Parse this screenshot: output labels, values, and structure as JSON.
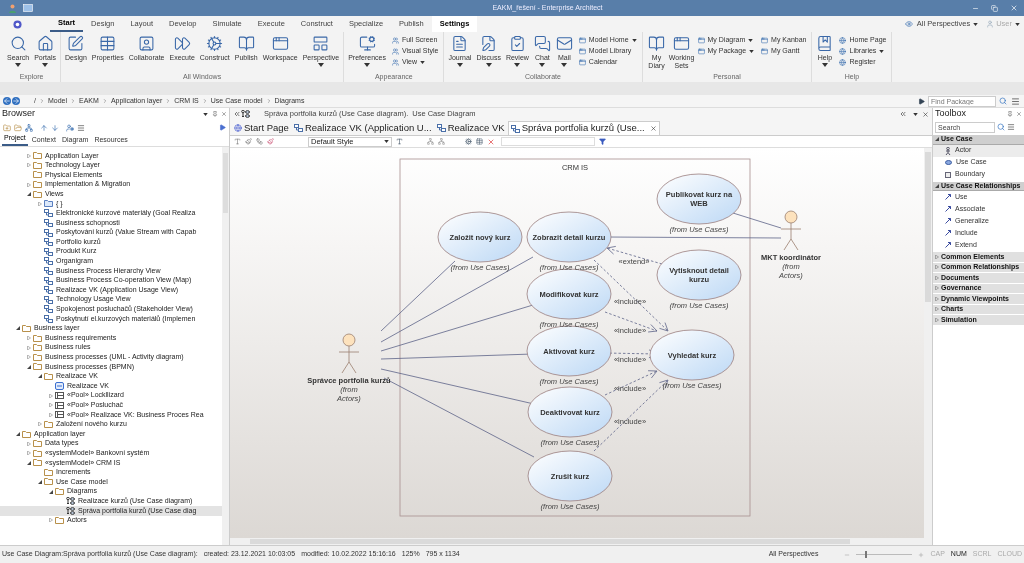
{
  "window": {
    "title": "EAKM_řešení - Enterprise Architect"
  },
  "ribbon": {
    "tabs": [
      {
        "label": "Start",
        "selected": true,
        "highlighted": false
      },
      {
        "label": "Design",
        "selected": false,
        "highlighted": false
      },
      {
        "label": "Layout",
        "selected": false,
        "highlighted": false
      },
      {
        "label": "Develop",
        "selected": false,
        "highlighted": false
      },
      {
        "label": "Simulate",
        "selected": false,
        "highlighted": false
      },
      {
        "label": "Execute",
        "selected": false,
        "highlighted": false
      },
      {
        "label": "Construct",
        "selected": false,
        "highlighted": false
      },
      {
        "label": "Specialize",
        "selected": false,
        "highlighted": false
      },
      {
        "label": "Publish",
        "selected": false,
        "highlighted": false
      },
      {
        "label": "Settings",
        "selected": false,
        "highlighted": true
      }
    ],
    "perspective": "All Perspectives",
    "user": "User",
    "groups": [
      {
        "label": "Explore",
        "items": [
          {
            "kind": "large",
            "label": "Search",
            "dropdown": true
          },
          {
            "kind": "large",
            "label": "Portals",
            "dropdown": true
          }
        ]
      },
      {
        "label": "All Windows",
        "items": [
          {
            "kind": "large",
            "label": "Design",
            "dropdown": false
          },
          {
            "kind": "large",
            "label": "Properties",
            "dropdown": false
          },
          {
            "kind": "large",
            "label": "Collaborate",
            "dropdown": false
          },
          {
            "kind": "large",
            "label": "Execute",
            "dropdown": false
          },
          {
            "kind": "large",
            "label": "Construct",
            "dropdown": false
          },
          {
            "kind": "large",
            "label": "Publish",
            "dropdown": false
          },
          {
            "kind": "large",
            "label": "Workspace",
            "dropdown": false
          },
          {
            "kind": "large",
            "label": "Perspective",
            "dropdown": true
          }
        ]
      },
      {
        "label": "Appearance",
        "items": [
          {
            "kind": "large",
            "label": "Preferences",
            "dropdown": true
          },
          {
            "kind": "stack",
            "items": [
              {
                "label": "Full Screen",
                "dropdown": false
              },
              {
                "label": "Visual Style",
                "dropdown": false
              },
              {
                "label": "View",
                "dropdown": true
              }
            ]
          }
        ]
      },
      {
        "label": "Collaborate",
        "items": [
          {
            "kind": "large",
            "label": "Journal",
            "dropdown": true
          },
          {
            "kind": "large",
            "label": "Discuss",
            "dropdown": true
          },
          {
            "kind": "large",
            "label": "Review",
            "dropdown": true
          },
          {
            "kind": "large",
            "label": "Chat",
            "dropdown": true
          },
          {
            "kind": "large",
            "label": "Mail",
            "dropdown": true
          },
          {
            "kind": "stack",
            "items": [
              {
                "label": "Model Home",
                "dropdown": true
              },
              {
                "label": "Model Library",
                "dropdown": false
              },
              {
                "label": "Calendar",
                "dropdown": false
              }
            ]
          }
        ]
      },
      {
        "label": "Personal",
        "items": [
          {
            "kind": "tall",
            "label": "My Diary",
            "dropdown": false
          },
          {
            "kind": "tall",
            "label": "Working Sets",
            "dropdown": false
          },
          {
            "kind": "stack",
            "items": [
              {
                "label": "My Diagram",
                "dropdown": true
              },
              {
                "label": "My Package",
                "dropdown": true
              }
            ]
          },
          {
            "kind": "stack",
            "items": [
              {
                "label": "My Kanban",
                "dropdown": false
              },
              {
                "label": "My Gantt",
                "dropdown": false
              }
            ]
          }
        ]
      },
      {
        "label": "Help",
        "items": [
          {
            "kind": "large",
            "label": "Help",
            "dropdown": true
          },
          {
            "kind": "stack",
            "items": [
              {
                "label": "Home Page",
                "dropdown": false
              },
              {
                "label": "Libraries",
                "dropdown": true
              },
              {
                "label": "Register",
                "dropdown": false
              }
            ]
          }
        ]
      }
    ]
  },
  "breadcrumb": {
    "items": [
      "/",
      "Model",
      "EAKM",
      "Application layer",
      "CRM IS",
      "Use Case model",
      "Diagrams"
    ],
    "search": {
      "placeholder": "Find Package"
    }
  },
  "browser": {
    "title": "Browser",
    "tabs": [
      {
        "label": "Project",
        "selected": true
      },
      {
        "label": "Context",
        "selected": false
      },
      {
        "label": "Diagram",
        "selected": false
      },
      {
        "label": "Resources",
        "selected": false
      }
    ],
    "tree": [
      {
        "children": [
          {
            "label": "Application Layer",
            "kind": "folder",
            "expanded": false,
            "selected": false
          },
          {
            "label": "Technology Layer",
            "kind": "folder",
            "expanded": false,
            "selected": false
          },
          {
            "label": "Physical Elements",
            "kind": "folder",
            "selected": false
          },
          {
            "label": "Implementation & Migration",
            "kind": "folder",
            "expanded": false,
            "selected": false
          },
          {
            "label": "Views",
            "kind": "folder",
            "expanded": true,
            "selected": false,
            "children": [
              {
                "label": "{ }",
                "kind": "package",
                "expanded": false,
                "selected": false
              },
              {
                "label": "Elektronické kurzové materiály (Goal Realiza",
                "kind": "view",
                "selected": false
              },
              {
                "label": "Business schopnosti",
                "kind": "view",
                "selected": false
              },
              {
                "label": "Poskytování kurzů (Value Stream with Capab",
                "kind": "view",
                "selected": false
              },
              {
                "label": "Portfolio kurzů",
                "kind": "view",
                "selected": false
              },
              {
                "label": "Produkt Kurz",
                "kind": "view",
                "selected": false
              },
              {
                "label": "Organigram",
                "kind": "view",
                "selected": false
              },
              {
                "label": "Business Process Hierarchy View",
                "kind": "view",
                "selected": false
              },
              {
                "label": "Business Process Co-operation View (Map)",
                "kind": "view",
                "selected": false
              },
              {
                "label": "Realizace VK (Application Usage View)",
                "kind": "view",
                "selected": false
              },
              {
                "label": "Technology Usage View",
                "kind": "view",
                "selected": false
              },
              {
                "label": "Spokojenost posluchačů (Stakeholder View)",
                "kind": "view",
                "selected": false
              },
              {
                "label": "Poskytnutí el.kurzových materiálů (Implemen",
                "kind": "view",
                "selected": false
              }
            ]
          }
        ]
      },
      {
        "label": "Business layer",
        "kind": "folder",
        "expanded": true,
        "selected": false,
        "children": [
          {
            "label": "Business requirements",
            "kind": "folder",
            "expanded": false,
            "selected": false
          },
          {
            "label": "Business rules",
            "kind": "folder",
            "expanded": false,
            "selected": false
          },
          {
            "label": "Business processes (UML - Activity diagram)",
            "kind": "folder",
            "expanded": false,
            "selected": false
          },
          {
            "label": "Business processes (BPMN)",
            "kind": "folder",
            "expanded": true,
            "selected": false,
            "children": [
              {
                "label": "Realizace VK",
                "kind": "folder",
                "expanded": true,
                "selected": false,
                "children": [
                  {
                    "label": "Realizace VK",
                    "kind": "bpmn",
                    "selected": false
                  },
                  {
                    "label": "«Pool» Lockllizard",
                    "kind": "pool",
                    "expanded": false,
                    "selected": false
                  },
                  {
                    "label": "«Pool» Posluchač",
                    "kind": "pool",
                    "expanded": false,
                    "selected": false
                  },
                  {
                    "label": "«Pool» Realizace VK: Business Proces Rea",
                    "kind": "pool",
                    "expanded": false,
                    "selected": false
                  }
                ]
              },
              {
                "label": "Založení nového kurzu",
                "kind": "folder",
                "expanded": false,
                "selected": false
              }
            ]
          }
        ]
      },
      {
        "label": "Application layer",
        "kind": "folder",
        "expanded": true,
        "selected": false,
        "children": [
          {
            "label": "Data types",
            "kind": "folder",
            "expanded": false,
            "selected": false
          },
          {
            "label": "«systemModel» Bankovní systém",
            "kind": "folder",
            "expanded": false,
            "selected": false
          },
          {
            "label": "«systemModel» CRM IS",
            "kind": "folder",
            "expanded": true,
            "selected": false,
            "children": [
              {
                "label": "Increments",
                "kind": "folder",
                "selected": false
              },
              {
                "label": "Use Case model",
                "kind": "folder",
                "expanded": true,
                "selected": false,
                "children": [
                  {
                    "label": "Diagrams",
                    "kind": "folder",
                    "expanded": true,
                    "selected": false,
                    "children": [
                      {
                        "label": "Realizace kurzů (Use Case diagram)",
                        "kind": "usecase",
                        "selected": false
                      },
                      {
                        "label": "Správa portfolia kurzů (Use Case diag",
                        "kind": "usecase",
                        "selected": true
                      }
                    ]
                  },
                  {
                    "label": "Actors",
                    "kind": "folder",
                    "expanded": false,
                    "selected": false
                  }
                ]
              }
            ]
          }
        ]
      }
    ]
  },
  "diagram_view": {
    "caption": "Správa portfolia kurzů (Use Case diagram).",
    "caption_type": "Use Case Diagram",
    "tabs": [
      {
        "label": "Start Page",
        "selected": false
      },
      {
        "label": "Realizace VK (Application U...",
        "selected": false
      },
      {
        "label": "Realizace VK",
        "selected": false
      },
      {
        "label": "Správa portfolia kurzů (Use...",
        "selected": true
      }
    ],
    "style": "Default Style",
    "diagram": {
      "boundary": "CRM IS",
      "use_cases": [
        {
          "name": "Založit nový kurz",
          "from": "(from Use Cases)"
        },
        {
          "name": "Zobrazit detail kurzu",
          "from": "(from Use Cases)"
        },
        {
          "name": "Publikovat kurz na WEB",
          "from": "(from Use Cases)"
        },
        {
          "name": "Vytisknout detail kurzu",
          "from": "(from Use Cases)"
        },
        {
          "name": "Modifikovat kurz",
          "from": "(from Use Cases)"
        },
        {
          "name": "Aktivovat kurz",
          "from": "(from Use Cases)"
        },
        {
          "name": "Vyhledat kurz",
          "from": "(from Use Cases)"
        },
        {
          "name": "Deaktivovat kurz",
          "from": "(from Use Cases)"
        },
        {
          "name": "Zrušit kurz",
          "from": "(from Use Cases)"
        }
      ],
      "actors": [
        {
          "name": "Správce portfolia kurzů",
          "from": "(from Actors)"
        },
        {
          "name": "MKT koordinátor",
          "from": "(from Actors)"
        }
      ],
      "connectors": [
        {
          "kind": "association"
        },
        {
          "kind": "association"
        },
        {
          "kind": "association"
        },
        {
          "kind": "association"
        },
        {
          "kind": "association"
        },
        {
          "kind": "association"
        },
        {
          "kind": "association"
        },
        {
          "kind": "association"
        },
        {
          "kind": "extend",
          "label": "«extend»"
        },
        {
          "kind": "include",
          "label": "«include»"
        },
        {
          "kind": "include",
          "label": "«include»"
        },
        {
          "kind": "include",
          "label": "«include»"
        },
        {
          "kind": "include",
          "label": "«include»"
        },
        {
          "kind": "include",
          "label": "«include»"
        }
      ]
    }
  },
  "toolbox": {
    "title": "Toolbox",
    "search": {
      "placeholder": "Search"
    },
    "sections": [
      {
        "label": "Use Case",
        "expanded": true,
        "items": [
          {
            "label": "Actor",
            "selected": true
          },
          {
            "label": "Use Case",
            "selected": false
          },
          {
            "label": "Boundary",
            "selected": false
          }
        ]
      },
      {
        "label": "Use Case Relationships",
        "expanded": true,
        "items": [
          {
            "label": "Use",
            "selected": false
          },
          {
            "label": "Associate",
            "selected": false
          },
          {
            "label": "Generalize",
            "selected": false
          },
          {
            "label": "Include",
            "selected": false
          },
          {
            "label": "Extend",
            "selected": false
          }
        ]
      },
      {
        "label": "Common Elements",
        "expanded": false
      },
      {
        "label": "Common Relationships",
        "expanded": false
      },
      {
        "label": "Documents",
        "expanded": false
      },
      {
        "label": "Governance",
        "expanded": false
      },
      {
        "label": "Dynamic Viewpoints",
        "expanded": false
      },
      {
        "label": "Charts",
        "expanded": false
      },
      {
        "label": "Simulation",
        "expanded": false
      }
    ]
  },
  "status_bar": {
    "text": "Use Case Diagram:Správa portfolia kurzů (Use Case diagram):",
    "created": "created: 23.12.2021 10:03:05",
    "modified": "modified: 10.02.2022 15:16:16",
    "zoom": "125%",
    "size": "795 x 1134",
    "perspective": "All Perspectives",
    "zoom_slider": {
      "level": 0.15
    },
    "indicators": [
      {
        "label": "CAP",
        "active": false
      },
      {
        "label": "NUM",
        "active": true
      },
      {
        "label": "SCRL",
        "active": false
      },
      {
        "label": "CLOUD",
        "active": false
      }
    ]
  }
}
